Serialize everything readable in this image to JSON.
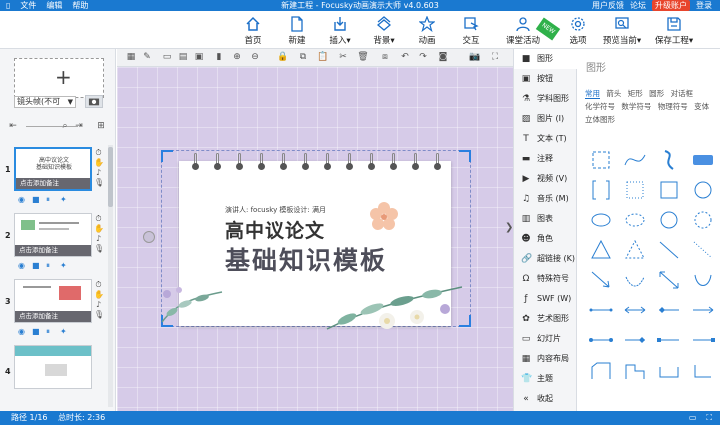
{
  "titlebar": {
    "menus": [
      "文件",
      "编辑",
      "帮助"
    ],
    "title": "新建工程 - Focusky动画演示大师  v4.0.603",
    "feedback": "用户反馈",
    "forum": "论坛",
    "upgrade": "升级账户",
    "login": "登录"
  },
  "toolbar": {
    "items": [
      {
        "label": "首页",
        "icon": "home-icon"
      },
      {
        "label": "新建",
        "icon": "new-file-icon"
      },
      {
        "label": "插入",
        "icon": "insert-icon"
      },
      {
        "label": "背景",
        "icon": "background-icon"
      },
      {
        "label": "动画",
        "icon": "animation-star-icon"
      },
      {
        "label": "交互",
        "icon": "interaction-icon"
      },
      {
        "label": "课堂活动",
        "icon": "classroom-icon"
      },
      {
        "label": "选项",
        "icon": "gear-icon"
      },
      {
        "label": "预览当前",
        "icon": "preview-icon"
      },
      {
        "label": "保存工程",
        "icon": "save-icon"
      }
    ],
    "new_badge": "NEW"
  },
  "left": {
    "camera_select": "镜头帧(不可",
    "slides": [
      {
        "num": "1",
        "title1": "高中议论文",
        "title2": "基础知识模板",
        "note": "点击添加备注"
      },
      {
        "num": "2",
        "title1": "",
        "title2": "",
        "note": "点击添加备注"
      },
      {
        "num": "3",
        "title1": "",
        "title2": "",
        "note": "点击添加备注"
      },
      {
        "num": "4",
        "title1": "",
        "title2": "",
        "note": ""
      }
    ]
  },
  "slide": {
    "speaker": "演讲人: focusky   模板设计: 满月",
    "title1": "高中议论文",
    "title2": "基础知识模板"
  },
  "right_tabs": [
    {
      "label": "图形",
      "icon": "shape-icon"
    },
    {
      "label": "按钮",
      "icon": "button-icon"
    },
    {
      "label": "学科图形",
      "icon": "subject-icon"
    },
    {
      "label": "图片 (I)",
      "icon": "image-icon"
    },
    {
      "label": "文本 (T)",
      "icon": "text-icon"
    },
    {
      "label": "注释",
      "icon": "comment-icon"
    },
    {
      "label": "视频 (V)",
      "icon": "video-icon"
    },
    {
      "label": "音乐 (M)",
      "icon": "music-icon"
    },
    {
      "label": "图表",
      "icon": "chart-icon"
    },
    {
      "label": "角色",
      "icon": "character-icon"
    },
    {
      "label": "超链接 (K)",
      "icon": "link-icon"
    },
    {
      "label": "特殊符号",
      "icon": "omega-icon"
    },
    {
      "label": "SWF (W)",
      "icon": "swf-icon"
    },
    {
      "label": "艺术图形",
      "icon": "art-icon"
    },
    {
      "label": "幻灯片",
      "icon": "slides-icon"
    },
    {
      "label": "内容布局",
      "icon": "layout-icon"
    },
    {
      "label": "主题",
      "icon": "theme-icon"
    },
    {
      "label": "收起",
      "icon": "collapse-icon"
    }
  ],
  "shape_panel": {
    "title": "图形",
    "categories_row1": [
      "常用",
      "箭头",
      "矩形",
      "圆形",
      "对话框"
    ],
    "categories_row2": [
      "化学符号",
      "数学符号",
      "物理符号",
      "变体"
    ],
    "categories_row3": [
      "立体图形"
    ]
  },
  "status": {
    "path": "路径 1/16",
    "duration": "总时长: 2:36"
  }
}
